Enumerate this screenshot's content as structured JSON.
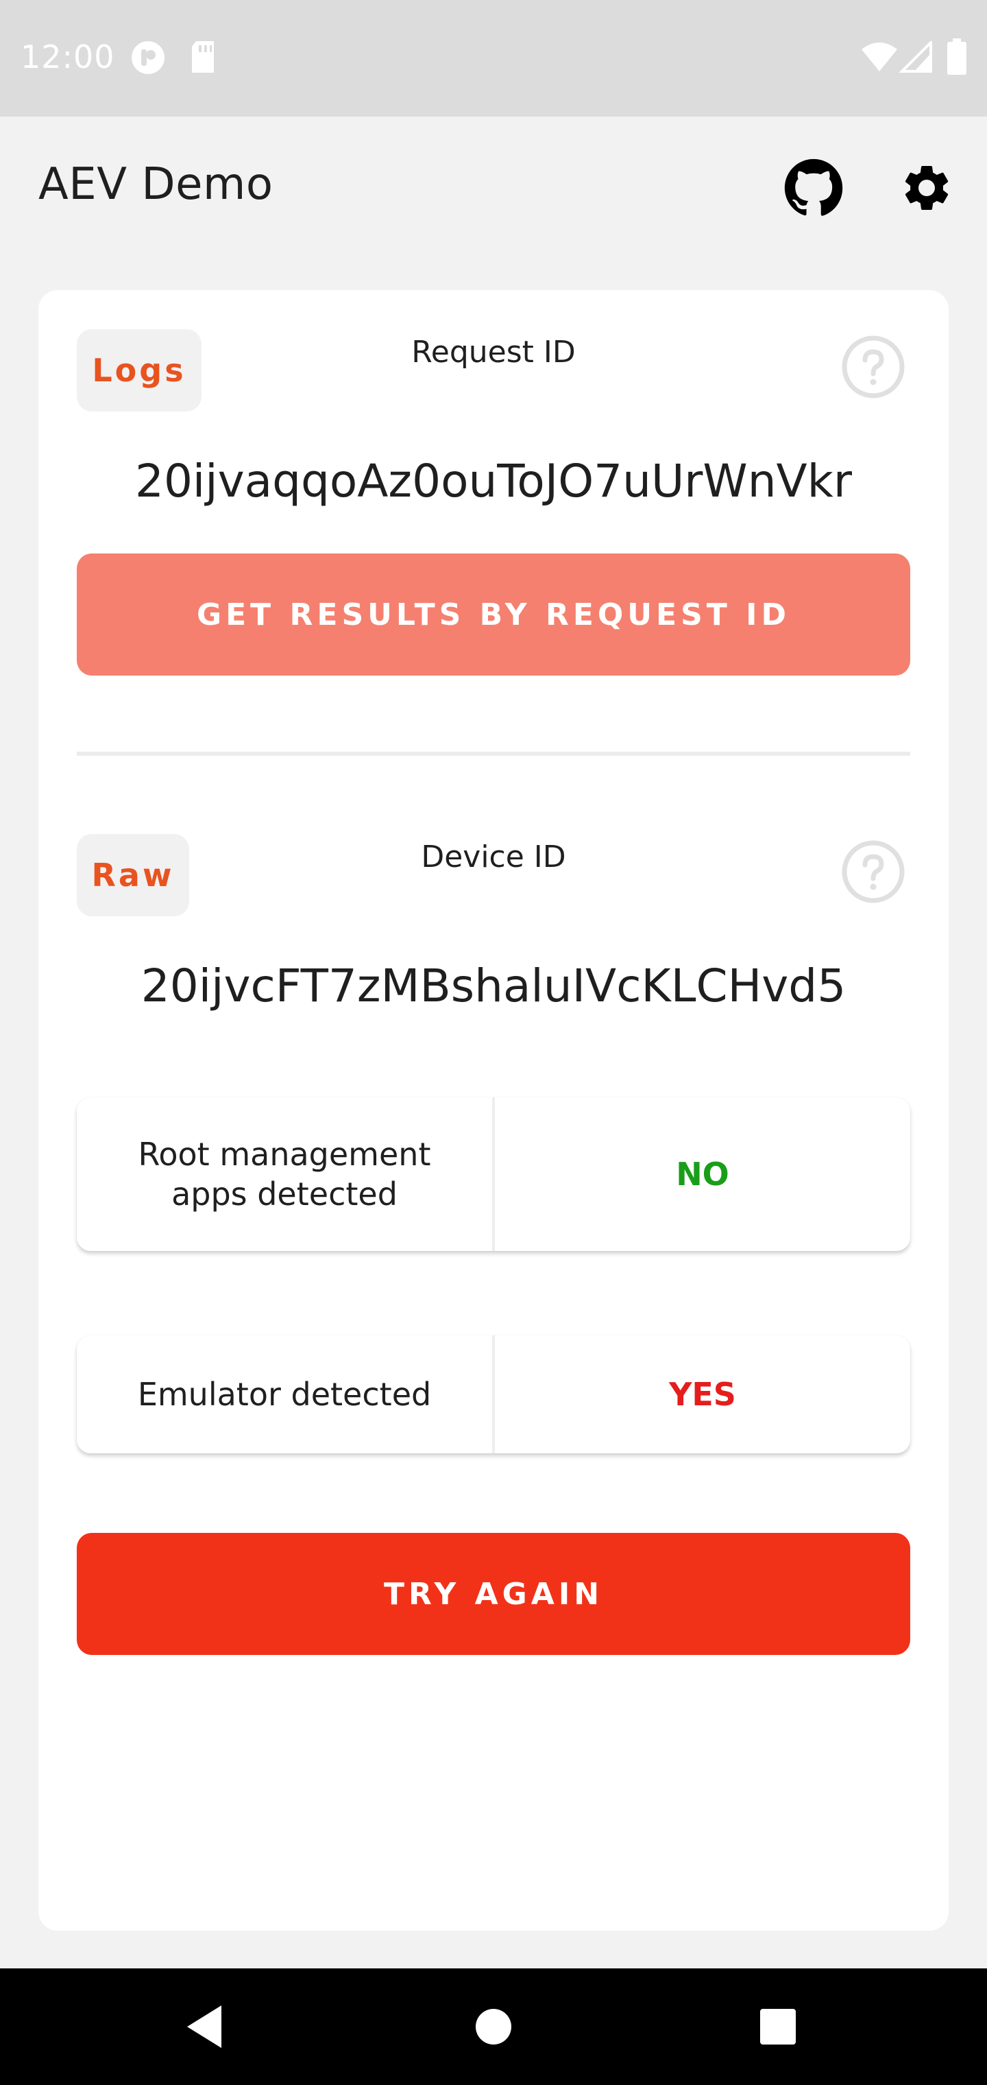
{
  "status_bar": {
    "time": "12:00",
    "icons": [
      "notification-icon",
      "sd-card-icon",
      "wifi-icon",
      "signal-icon",
      "battery-icon"
    ]
  },
  "app_bar": {
    "title": "AEV Demo",
    "icons": [
      "github-icon",
      "settings-gear-icon"
    ]
  },
  "request_section": {
    "chip_label": "Logs",
    "label": "Request ID",
    "value": "20ijvaqqoAz0ouToJO7uUrWnVkr",
    "button_label": "GET RESULTS BY REQUEST ID"
  },
  "device_section": {
    "chip_label": "Raw",
    "label": "Device ID",
    "value": "20ijvcFT7zMBshaluIVcKLCHvd5"
  },
  "results": [
    {
      "label_line1": "Root management",
      "label_line2": "apps detected",
      "value": "NO",
      "status": "ok"
    },
    {
      "label_line1": "Emulator detected",
      "label_line2": "",
      "value": "YES",
      "status": "alert"
    }
  ],
  "try_again_label": "TRY AGAIN",
  "colors": {
    "accent": "#e8531f",
    "primary_button": "#f23218",
    "light_button": "#f5806f",
    "positive": "#1a9e1a",
    "negative": "#e51d1d"
  },
  "nav_bar": {
    "icons": [
      "back-icon",
      "home-icon",
      "recents-icon"
    ]
  }
}
